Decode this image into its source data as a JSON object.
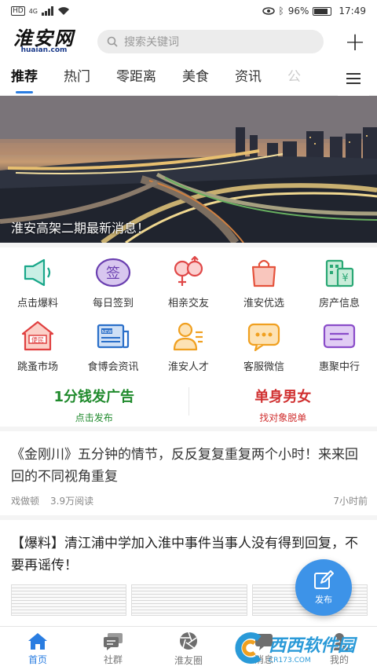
{
  "status": {
    "network": "4G",
    "battery": "96%",
    "time": "17:49"
  },
  "header": {
    "logo_text": "淮安网",
    "logo_sub": "huaian.com",
    "search_placeholder": "搜索关键词"
  },
  "tabs": [
    {
      "label": "推荐"
    },
    {
      "label": "热门"
    },
    {
      "label": "零距离"
    },
    {
      "label": "美食"
    },
    {
      "label": "资讯"
    },
    {
      "label": "公"
    }
  ],
  "banner": {
    "caption": "淮安高架二期最新消息！"
  },
  "grid": [
    {
      "label": "点击爆料",
      "icon": "megaphone-icon",
      "color": "#19a78a"
    },
    {
      "label": "每日签到",
      "icon": "sign-in-icon",
      "color": "#6a3fb0"
    },
    {
      "label": "相亲交友",
      "icon": "dating-icon",
      "color": "#e04848"
    },
    {
      "label": "淮安优选",
      "icon": "shopping-bag-icon",
      "color": "#e5533d"
    },
    {
      "label": "房产信息",
      "icon": "house-price-icon",
      "color": "#2aa875"
    },
    {
      "label": "跳蚤市场",
      "icon": "flea-market-icon",
      "color": "#e04040"
    },
    {
      "label": "食博会资讯",
      "icon": "newspaper-icon",
      "color": "#2a6fc9"
    },
    {
      "label": "淮安人才",
      "icon": "talent-icon",
      "color": "#f0a020"
    },
    {
      "label": "客服微信",
      "icon": "chat-icon",
      "color": "#f0a020"
    },
    {
      "label": "惠聚中行",
      "icon": "card-icon",
      "color": "#8a4cc9"
    }
  ],
  "promo": [
    {
      "title": "1分钱发广告",
      "sub": "点击发布",
      "color": "#1f8a2c"
    },
    {
      "title": "单身男女",
      "sub": "找对象脱单",
      "color": "#d03030"
    }
  ],
  "articles": [
    {
      "title": "《金刚川》五分钟的情节，反反复复重复两个小时！来来回回的不同视角重复",
      "author": "戏做顿",
      "reads": "3.9万阅读",
      "time": "7小时前"
    },
    {
      "title": "【爆料】清江浦中学加入淮中事件当事人没有得到回复，不要再谣传！"
    }
  ],
  "fab": {
    "label": "发布"
  },
  "bottom_nav": [
    {
      "label": "首页",
      "icon": "home-icon"
    },
    {
      "label": "社群",
      "icon": "community-icon"
    },
    {
      "label": "淮友圈",
      "icon": "aperture-icon"
    },
    {
      "label": "消息",
      "icon": "message-icon"
    },
    {
      "label": "我的",
      "icon": "profile-icon"
    }
  ],
  "watermark": {
    "text": "西西软件园",
    "sub": "CR173.COM"
  },
  "colors": {
    "accent": "#2a7de1",
    "fab": "#3d93e8"
  }
}
